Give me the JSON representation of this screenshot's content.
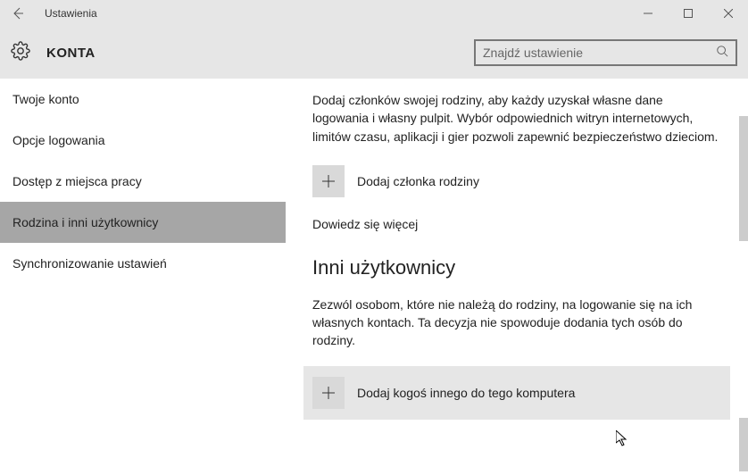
{
  "titlebar": {
    "app_title": "Ustawienia"
  },
  "header": {
    "section_title": "KONTA",
    "search_placeholder": "Znajdź ustawienie"
  },
  "sidebar": {
    "items": [
      {
        "label": "Twoje konto"
      },
      {
        "label": "Opcje logowania"
      },
      {
        "label": "Dostęp z miejsca pracy"
      },
      {
        "label": "Rodzina i inni użytkownicy"
      },
      {
        "label": "Synchronizowanie ustawień"
      }
    ]
  },
  "main": {
    "family_desc": "Dodaj członków swojej rodziny, aby każdy uzyskał własne dane logowania i własny pulpit. Wybór odpowiednich witryn internetowych, limitów czasu, aplikacji i gier pozwoli zapewnić bezpieczeństwo dzieciom.",
    "add_family_label": "Dodaj członka rodziny",
    "learn_more": "Dowiedz się więcej",
    "other_users_heading": "Inni użytkownicy",
    "other_users_desc": "Zezwól osobom, które nie należą do rodziny, na logowanie się na ich własnych kontach. Ta decyzja nie spowoduje dodania tych osób do rodziny.",
    "add_other_label": "Dodaj kogoś innego do tego komputera"
  }
}
